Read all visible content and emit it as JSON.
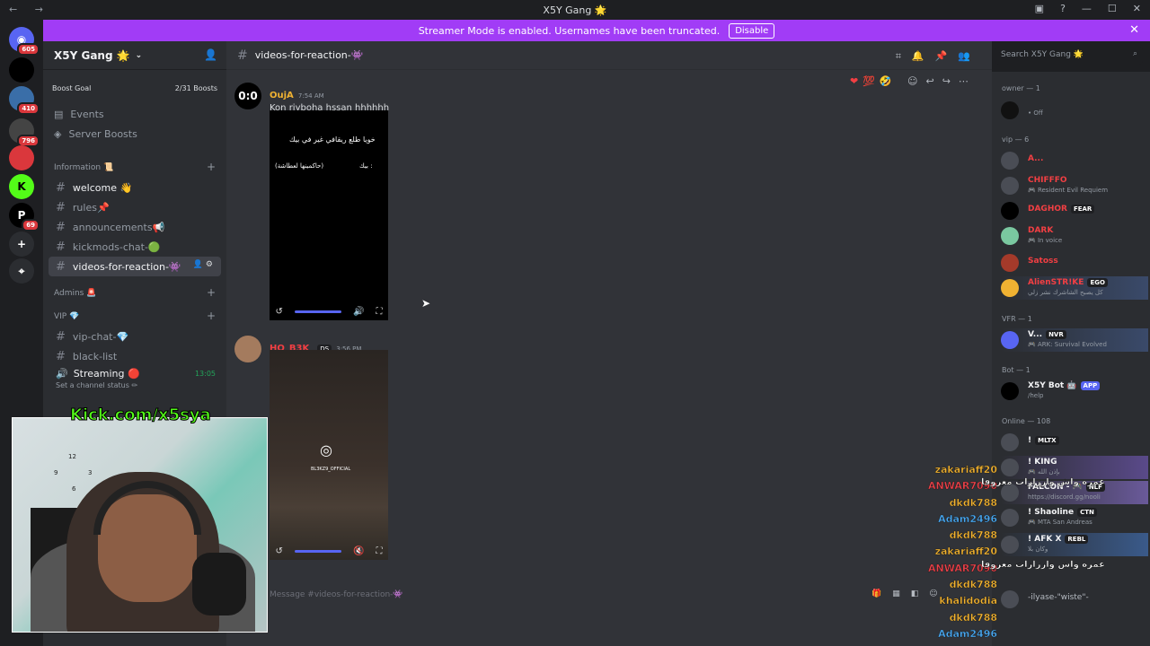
{
  "window": {
    "title": "X5Y Gang 🌟"
  },
  "banner": {
    "text": "Streamer Mode is enabled. Usernames have been truncated.",
    "disable_label": "Disable"
  },
  "servers": [
    {
      "label": "605",
      "badge": "605"
    },
    {
      "label": "410",
      "badge": "410"
    },
    {
      "label": "796",
      "badge": "796"
    },
    {
      "label": "69",
      "badge": "69"
    }
  ],
  "guild": {
    "name": "X5Y Gang 🌟",
    "boost_label": "Boost Goal",
    "boost_count": "2/31 Boosts"
  },
  "nav": {
    "events": "Events",
    "server_boosts": "Server Boosts"
  },
  "categories": {
    "information": "Information 📜",
    "admins": "Admins 🚨",
    "vip": "VIP 💎"
  },
  "channels": {
    "info": [
      {
        "name": "welcome 👋"
      },
      {
        "name": "rules📌"
      },
      {
        "name": "announcements📢"
      },
      {
        "name": "kickmods-chat-🟢"
      },
      {
        "name": "videos-for-reaction-👾"
      }
    ],
    "vip": [
      {
        "name": "vip-chat-💎"
      },
      {
        "name": "black-list"
      }
    ],
    "streaming": {
      "name": "Streaming 🔴",
      "status": "Set a channel status ✏",
      "time": "13:05"
    }
  },
  "chat": {
    "channel": "videos-for-reaction-👾",
    "search_placeholder": "Search X5Y Gang 🌟",
    "input_placeholder": "Message #videos-for-reaction-👾",
    "messages": [
      {
        "avatar": "0:0",
        "author": "OujA",
        "time": "7:54 AM",
        "content": "Kon riyboha hssan hhhhhh",
        "video_text_1": "خويا طلع ريقافي غير في بيك",
        "video_text_2": "بيك :",
        "video_text_3": "(حاكمينها لعطاشة)"
      },
      {
        "author": "HO_B3K",
        "tag": "DS",
        "time": "3:56 PM",
        "video_caption": "BL3KZ9_OFFICIAL"
      }
    ]
  },
  "members": {
    "groups": [
      {
        "label": "owner — 1"
      },
      {
        "label": "vip — 6"
      },
      {
        "label": "VFR — 1"
      },
      {
        "label": "Bot — 1"
      },
      {
        "label": "Online — 108"
      }
    ],
    "owner": [
      {
        "name": "",
        "status": "• Off"
      }
    ],
    "vip": [
      {
        "name": "A...",
        "status": "",
        "color": "#f23f43"
      },
      {
        "name": "CHIFFFO",
        "status": "🎮 Resident Evil Requiem",
        "color": "#f23f43"
      },
      {
        "name": "DAGHOR",
        "tag": "FEAR",
        "status": "",
        "color": "#f23f43"
      },
      {
        "name": "DARK",
        "status": "🎮 In voice",
        "color": "#f23f43"
      },
      {
        "name": "Satoss",
        "status": "",
        "color": "#f23f43"
      },
      {
        "name": "AlienSTR!KE",
        "tag": "EGO",
        "status": "كل يصبح الشاشرك نشر زلي",
        "color": "#f23f43"
      }
    ],
    "vfr": [
      {
        "name": "V...",
        "tag": "NVR",
        "status": "🎮 ARK: Survival Evolved",
        "color": "#b5bac1"
      }
    ],
    "bot": [
      {
        "name": "X5Y Bot 🤖",
        "tag": "APP",
        "status": "/help",
        "color": "#f2f3f5"
      }
    ],
    "online": [
      {
        "name": "!",
        "tag": "MLTX",
        "status": ""
      },
      {
        "name": "! KING",
        "status": "🎮 ﺑﺈﺫﻥ ﺍﻟﻠﻪ"
      },
      {
        "name": "FALCON - 🎮",
        "tag": "NLF",
        "status": "https://discord.gg/nooli"
      },
      {
        "name": "! Shaoline",
        "tag": "CTN",
        "status": "🎮 MTA San Andreas"
      },
      {
        "name": "! AFK X",
        "tag": "REBL",
        "status": "وكان بلا"
      },
      {
        "name": "-ilyase-\"wiste\"-",
        "status": ""
      }
    ]
  },
  "overlay": {
    "kick_label": "Kick.com/x5sya",
    "stream_chat": [
      {
        "user": "zakariaff20",
        "color": "#f0b232"
      },
      {
        "user": "ANWAR7090",
        "color": "#e8424a"
      },
      {
        "user": "dkdk788",
        "color": "#f0b232"
      },
      {
        "user": "Adam2496",
        "color": "#4aa8f0"
      },
      {
        "user": "dkdk788",
        "color": "#f0b232"
      },
      {
        "user": "zakariaff20",
        "color": "#f0b232"
      },
      {
        "user": "ANWAR7090",
        "color": "#e8424a"
      },
      {
        "user": "dkdk788",
        "color": "#f0b232"
      },
      {
        "user": "khalidodia",
        "color": "#f0b232"
      },
      {
        "user": "dkdk788",
        "color": "#f0b232"
      },
      {
        "user": "Adam2496",
        "color": "#4aa8f0"
      }
    ],
    "arabic_line": "عمره واش وارزازات معروفا",
    "clock_numbers": [
      "12",
      "3",
      "6",
      "9"
    ]
  },
  "colors": {
    "accent": "#a13cf6",
    "brand": "#5865f2",
    "online": "#23a55a"
  }
}
